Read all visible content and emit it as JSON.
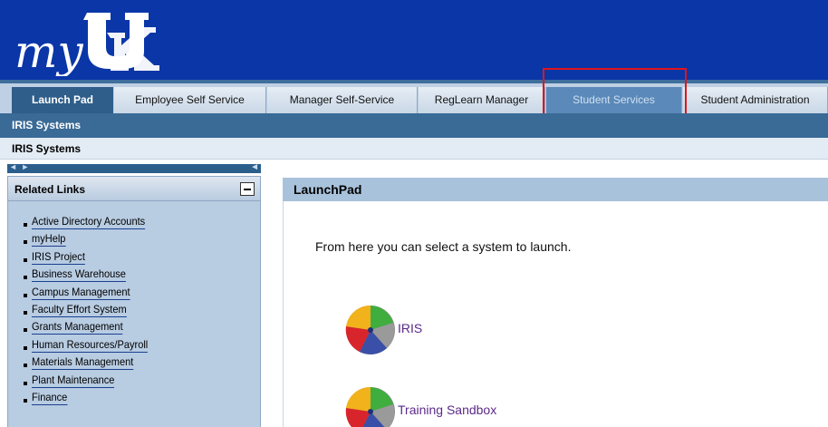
{
  "header": {
    "logo_text": "myUK"
  },
  "tabs": [
    {
      "label": "Launch Pad"
    },
    {
      "label": "Employee Self Service"
    },
    {
      "label": "Manager Self-Service"
    },
    {
      "label": "RegLearn Manager"
    },
    {
      "label": "Student Services"
    },
    {
      "label": "Student Administration"
    }
  ],
  "subnav": {
    "label": "IRIS Systems"
  },
  "breadcrumb": {
    "label": "IRIS Systems"
  },
  "sidebar": {
    "title": "Related Links",
    "links": [
      {
        "label": "Active Directory Accounts"
      },
      {
        "label": "myHelp"
      },
      {
        "label": "IRIS Project"
      },
      {
        "label": "Business Warehouse"
      },
      {
        "label": "Campus Management"
      },
      {
        "label": "Faculty Effort System"
      },
      {
        "label": "Grants Management"
      },
      {
        "label": "Human Resources/Payroll"
      },
      {
        "label": "Materials Management"
      },
      {
        "label": "Plant Maintenance"
      },
      {
        "label": "Finance"
      }
    ]
  },
  "main": {
    "title": "LaunchPad",
    "intro": "From here you can select a system to launch.",
    "systems": [
      {
        "label": "IRIS"
      },
      {
        "label": "Training Sandbox"
      }
    ]
  },
  "colors": {
    "header_bg": "#0a36a8",
    "tab_active": "#2f5e8a",
    "highlight_box": "#e0151d",
    "link_visited": "#5b2a8a"
  }
}
